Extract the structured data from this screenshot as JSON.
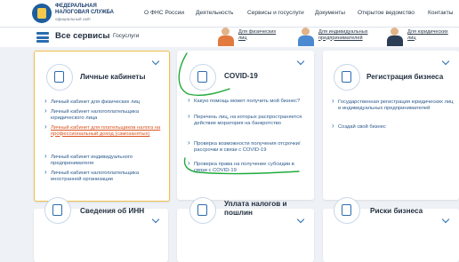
{
  "header": {
    "brand_line1": "ФЕДЕРАЛЬНАЯ",
    "brand_line2": "НАЛОГОВАЯ СЛУЖБА",
    "brand_sub": "официальный сайт",
    "nav": [
      "О ФНС России",
      "Деятельность",
      "Сервисы и госуслуги",
      "Документы",
      "Открытое ведомство",
      "Контакты"
    ]
  },
  "subheader": {
    "title": "Все сервисы",
    "gosuslugi": "Госуслуги",
    "persona_tabs": [
      {
        "line1": "Для физических",
        "line2": "лиц"
      },
      {
        "line1": "Для индивидуальных",
        "line2": "предпринимателей"
      },
      {
        "line1": "Для юридических",
        "line2": "лиц"
      }
    ]
  },
  "cards": {
    "cabinets": {
      "title": "Личные кабинеты",
      "links": [
        "Личный кабинет для физических лиц",
        "Личный кабинет налогоплательщика юридического лица",
        "Личный кабинет для плательщиков налога на профессиональный доход (самозанятых)",
        "Личный кабинет индивидуального предпринимателя",
        "Личный кабинет налогоплательщика иностранной организации"
      ]
    },
    "covid": {
      "title": "COVID-19",
      "links": [
        "Какую помощь может получить мой бизнес?",
        "Перечень лиц, на которых распространяется действие моратория на банкротство",
        "Проверка возможности получения отсрочки/рассрочки в связи с COVID-19",
        "Проверка права на получение субсидии в связи с COVID-19"
      ]
    },
    "business": {
      "title": "Регистрация бизнеса",
      "links": [
        "Государственная регистрация юридических лиц и индивидуальных предпринимателей",
        "Создай свой бизнес"
      ]
    },
    "inn": {
      "title": "Сведения об ИНН"
    },
    "taxes": {
      "title_line1": "Уплата налогов и",
      "title_line2": "пошлин"
    },
    "risks": {
      "title": "Риски бизнеса"
    }
  },
  "colors": {
    "accent": "#2b6cb0",
    "annotation": "#1faa3b",
    "highlight": "#d9531e"
  }
}
